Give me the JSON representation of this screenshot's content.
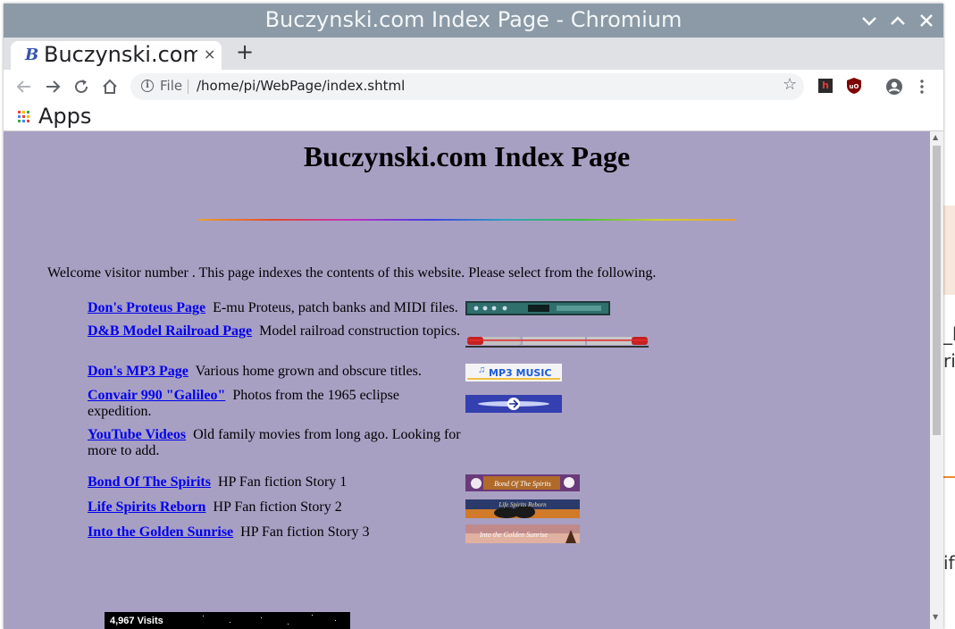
{
  "window": {
    "title": "Buczynski.com Index Page - Chromium"
  },
  "tab": {
    "favicon": "B",
    "label": "Buczynski.com Index Page",
    "close": "×",
    "new_tab": "+"
  },
  "omnibox": {
    "scheme_label": "File",
    "url": "/home/pi/WebPage/index.shtml"
  },
  "extensions": {
    "ext1": "h",
    "ext2": "uO"
  },
  "bookmarks": {
    "apps_label": "Apps"
  },
  "page": {
    "heading": "Buczynski.com Index Page",
    "welcome": "Welcome visitor number . This page indexes the contents of this website. Please select from the following.",
    "entries": [
      {
        "link": "Don's Proteus Page",
        "desc": "E-mu Proteus, patch banks and MIDI files."
      },
      {
        "link": "D&B Model Railroad Page",
        "desc": "Model railroad construction topics."
      },
      {
        "link": "Don's MP3 Page",
        "desc": "Various home grown and obscure titles."
      },
      {
        "link": "Convair 990 \"Galileo\"",
        "desc": "Photos from the 1965 eclipse expedition."
      },
      {
        "link": "YouTube Videos",
        "desc": "Old family movies from long ago. Looking for more to add."
      },
      {
        "link": "Bond Of The Spirits",
        "desc": "HP Fan fiction Story 1"
      },
      {
        "link": "Life Spirits Reborn",
        "desc": "HP Fan fiction Story 2"
      },
      {
        "link": "Into the Golden Sunrise",
        "desc": "HP Fan fiction Story 3"
      }
    ],
    "banners": {
      "mp3": "MP3 MUSIC",
      "bond": "Bond Of The Spirits",
      "life": "Life Spirits Reborn",
      "golden": "Into the Golden Sunrise"
    },
    "counter": "4,967 Visits"
  },
  "background_window": {
    "text1": "_k",
    "text2": "ri",
    "text3": "if"
  }
}
